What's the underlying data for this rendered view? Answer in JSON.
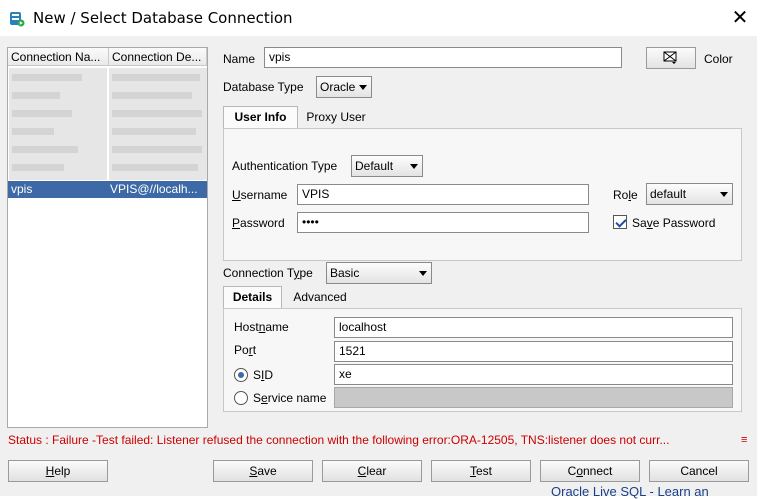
{
  "window": {
    "title": "New / Select Database Connection",
    "close_glyph": "✕"
  },
  "connection_list": {
    "headers": [
      "Connection Na...",
      "Connection De..."
    ],
    "selected": {
      "name": "vpis",
      "details": "VPIS@//localh..."
    }
  },
  "form": {
    "name_label": "Name",
    "name_value": "vpis",
    "color_label": "Color",
    "database_type_label": "Database Type",
    "database_type_value": "Oracle",
    "tabs_top": [
      "User Info",
      "Proxy User"
    ],
    "auth_type_label": "Authentication Type",
    "auth_type_value": "Default",
    "username_label_first": "U",
    "username_label_rest": "sername",
    "username_value": "VPIS",
    "password_label_first": "P",
    "password_label_rest": "assword",
    "password_value": "••••",
    "role_label_pre": "Ro",
    "role_label_u": "l",
    "role_label_post": "e",
    "role_value": "default",
    "save_password_pre": "Sa",
    "save_password_u": "v",
    "save_password_post": "e Password",
    "connection_type_label_pre": "Connection T",
    "connection_type_label_u": "y",
    "connection_type_label_post": "pe",
    "connection_type_value": "Basic",
    "tabs_bottom": [
      "Details",
      "Advanced"
    ],
    "hostname_label_pre": "Host",
    "hostname_label_u": "n",
    "hostname_label_post": "ame",
    "hostname_value": "localhost",
    "port_label_pre": "Po",
    "port_label_u": "r",
    "port_label_post": "t",
    "port_value": "1521",
    "sid_label_pre": "S",
    "sid_label_u": "I",
    "sid_label_post": "D",
    "sid_value": "xe",
    "service_name_label_pre": "S",
    "service_name_label_u": "e",
    "service_name_label_post": "rvice name"
  },
  "status": {
    "text": "Status : Failure -Test failed: Listener refused the connection with the following error:ORA-12505, TNS:listener does not curr...",
    "icon": "≡"
  },
  "buttons": {
    "help_u": "H",
    "help_rest": "elp",
    "save_u": "S",
    "save_rest": "ave",
    "clear_u": "C",
    "clear_rest": "lear",
    "test_u": "T",
    "test_rest": "est",
    "connect_pre": "C",
    "connect_u": "o",
    "connect_rest": "nnect",
    "cancel": "Cancel"
  },
  "background": {
    "link_text": "Oracle Live SQL - Learn an"
  },
  "colors": {
    "status_red": "#cc0000",
    "selection_blue": "#3d6aa6",
    "dialog_bg": "#f0f0f0"
  }
}
